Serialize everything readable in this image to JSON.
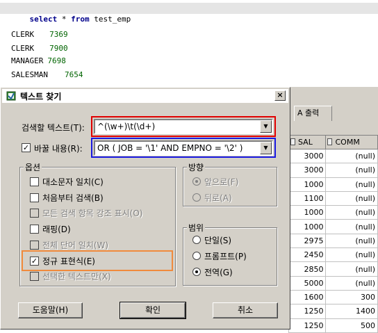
{
  "editor": {
    "sql": {
      "kw1": "select",
      "star": " * ",
      "kw2": "from",
      "table": " test_emp"
    },
    "rows": [
      {
        "job": "CLERK",
        "empno": "7369"
      },
      {
        "job": "CLERK",
        "empno": "7900"
      },
      {
        "job": "MANAGER",
        "empno": "7698"
      },
      {
        "job": "SALESMAN",
        "empno": "7654"
      }
    ]
  },
  "grid": {
    "tab_label": "A 출력",
    "columns": [
      "SAL",
      "COMM"
    ],
    "rows": [
      [
        "3000",
        "(null)"
      ],
      [
        "3000",
        "(null)"
      ],
      [
        "1000",
        "(null)"
      ],
      [
        "1100",
        "(null)"
      ],
      [
        "1000",
        "(null)"
      ],
      [
        "1000",
        "(null)"
      ],
      [
        "2975",
        "(null)"
      ],
      [
        "2450",
        "(null)"
      ],
      [
        "2850",
        "(null)"
      ],
      [
        "5000",
        "(null)"
      ],
      [
        "1600",
        "300"
      ],
      [
        "1250",
        "1400"
      ],
      [
        "1250",
        "500"
      ]
    ]
  },
  "dialog": {
    "title": "텍스트 찾기",
    "close_glyph": "×",
    "search_label": "검색할 텍스트(T):",
    "search_value": "^(\\w+)\\t(\\d+)",
    "replace_label": "바꿀 내용(R):",
    "replace_value": "OR ( JOB = '\\1' AND EMPNO = '\\2' )",
    "replace_checked": true,
    "options_title": "옵션",
    "options": [
      {
        "label": "대소문자 일치(C)",
        "checked": false,
        "disabled": false
      },
      {
        "label": "처음부터 검색(B)",
        "checked": false,
        "disabled": false
      },
      {
        "label": "모든 검색 항목 강조 표시(O)",
        "checked": false,
        "disabled": true
      },
      {
        "label": "래핑(D)",
        "checked": false,
        "disabled": false
      },
      {
        "label": "전체 단어 일치(W)",
        "checked": false,
        "disabled": true
      },
      {
        "label": "정규 표현식(E)",
        "checked": true,
        "disabled": false
      },
      {
        "label": "선택한 텍스트만(X)",
        "checked": false,
        "disabled": true
      }
    ],
    "direction_title": "방향",
    "direction": [
      {
        "label": "앞으로(F)",
        "selected": true,
        "disabled": true
      },
      {
        "label": "뒤로(A)",
        "selected": false,
        "disabled": true
      }
    ],
    "scope_title": "범위",
    "scope": [
      {
        "label": "단일(S)",
        "selected": false
      },
      {
        "label": "프롬프트(P)",
        "selected": false
      },
      {
        "label": "전역(G)",
        "selected": true
      }
    ],
    "buttons": {
      "help": "도움말(H)",
      "ok": "확인",
      "cancel": "취소"
    }
  },
  "colors": {
    "highlight_red": "#e00000",
    "highlight_blue": "#1a1ae0",
    "highlight_orange": "#f08a3c",
    "dialog_face": "#d4d0c8"
  },
  "icons": [
    "find-dialog-icon",
    "close-icon",
    "dropdown-arrow-icon",
    "column-header-icon"
  ]
}
